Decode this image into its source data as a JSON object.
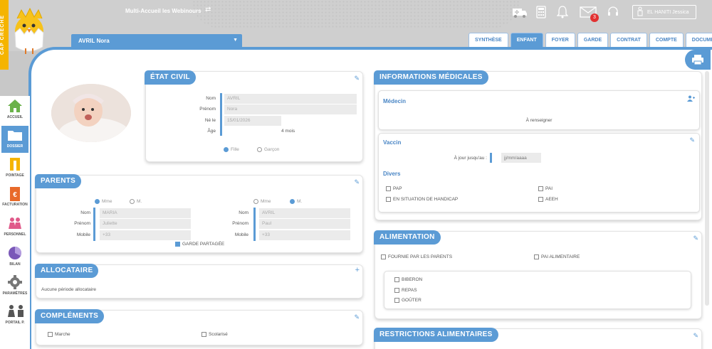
{
  "brand": {
    "vertical_text": "CAP CRÈCHE"
  },
  "header": {
    "title": "Multi-Accueil les Webinours",
    "user_name": "EL HANITI Jessica",
    "messages_count": "3"
  },
  "child": {
    "selected": "AVRIL Nora"
  },
  "tabs": [
    "SYNTHÈSE",
    "ENFANT",
    "FOYER",
    "GARDE",
    "CONTRAT",
    "COMPTE",
    "DOCUMENTS"
  ],
  "active_tab": "ENFANT",
  "sidebar": [
    {
      "label": "ACCUEIL",
      "icon": "home-icon",
      "color": "#6bb24a"
    },
    {
      "label": "DOSSIER",
      "icon": "folder-icon",
      "color": "#ffffff"
    },
    {
      "label": "POINTAGE",
      "icon": "pointage-icon",
      "color": "#f5b400"
    },
    {
      "label": "FACTURATION",
      "icon": "invoice-icon",
      "color": "#e86a2a"
    },
    {
      "label": "PERSONNEL",
      "icon": "staff-icon",
      "color": "#e05a8a"
    },
    {
      "label": "BILAN",
      "icon": "chart-icon",
      "color": "#7a58b8"
    },
    {
      "label": "PARAMÈTRES",
      "icon": "gear-icon",
      "color": "#777777"
    },
    {
      "label": "PORTAIL P.",
      "icon": "family-icon",
      "color": "#555555"
    }
  ],
  "etat_civil": {
    "title": "ÉTAT CIVIL",
    "fields": [
      {
        "label": "Nom",
        "value": "AVRIL"
      },
      {
        "label": "Prénom",
        "value": "Nora"
      },
      {
        "label": "Né le",
        "value": "15/01/2026"
      },
      {
        "label": "Âge",
        "value": "4 mois"
      }
    ],
    "gender_options": [
      "Fille",
      "Garçon"
    ]
  },
  "parents": {
    "title": "PARENTS",
    "civility": [
      "Mme",
      "M."
    ],
    "labels": [
      "Nom",
      "Prénom",
      "Mobile"
    ],
    "parent1": {
      "nom": "MARIA",
      "prenom": "Juliette",
      "mobile": "+33"
    },
    "parent2": {
      "nom": "AVRIL",
      "prenom": "Paul",
      "mobile": "+33"
    },
    "shared_custody": "GARDE PARTAGÉE"
  },
  "allocataire": {
    "title": "ALLOCATAIRE",
    "text": "Aucune période allocataire"
  },
  "complements": {
    "title": "COMPLÉMENTS",
    "options": [
      "Marche",
      "Scolarisé"
    ]
  },
  "medical": {
    "title": "INFORMATIONS MÉDICALES",
    "doctor_title": "Médecin",
    "doctor_text": "À renseigner",
    "vaccine_title": "Vaccin",
    "vaccine_label": "À jour jusqu'au :",
    "vaccine_placeholder": "jj/mm/aaaa",
    "divers_title": "Divers",
    "divers_options": [
      "PAP",
      "PAI",
      "EN SITUATION DE HANDICAP",
      "AEEH"
    ]
  },
  "alimentation": {
    "title": "ALIMENTATION",
    "options": [
      "FOURNIE PAR LES PARENTS",
      "PAI ALIMENTAIRE"
    ],
    "meals": [
      "BIBERON",
      "REPAS",
      "GOÛTER"
    ]
  },
  "restrictions": {
    "title": "RESTRICTIONS ALIMENTAIRES"
  }
}
